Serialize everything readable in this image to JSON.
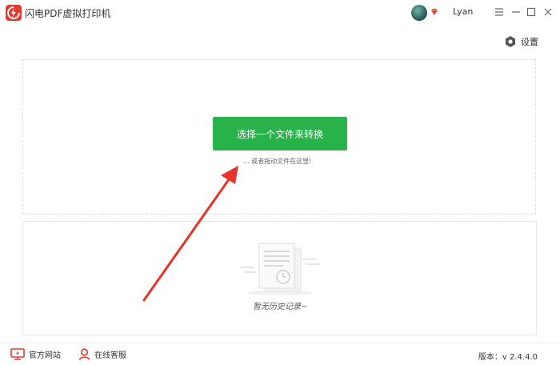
{
  "app": {
    "title": "闪电PDF虚拟打印机"
  },
  "user": {
    "name": "Lyan"
  },
  "toolbar": {
    "settings_label": "设置"
  },
  "main": {
    "select_button_label": "选择一个文件来转换",
    "drag_hint": "... 或者拖动文件在这里!"
  },
  "history": {
    "empty_text": "暂无历史记录~"
  },
  "footer": {
    "official_site_label": "官方网站",
    "online_service_label": "在线客服",
    "version_text": "版本：v 2.4.4.0"
  },
  "colors": {
    "accent_green": "#27b24a",
    "brand_red": "#e23a2e",
    "arrow_red": "#e8332a"
  }
}
